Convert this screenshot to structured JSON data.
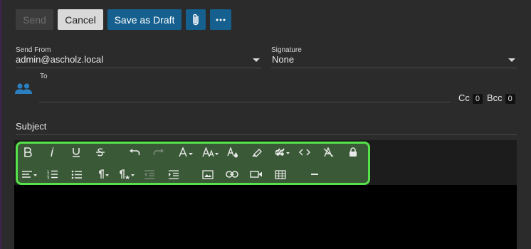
{
  "toolbar": {
    "send_label": "Send",
    "cancel_label": "Cancel",
    "draft_label": "Save as Draft",
    "attach_icon": "paperclip-icon",
    "more_icon": "more-horizontal-icon"
  },
  "send_from": {
    "label": "Send From",
    "value": "admin@ascholz.local"
  },
  "signature": {
    "label": "Signature",
    "value": "None"
  },
  "to": {
    "label": "To",
    "icon": "contacts-icon"
  },
  "cc": {
    "label": "Cc",
    "count": "0"
  },
  "bcc": {
    "label": "Bcc",
    "count": "0"
  },
  "subject": {
    "label": "Subject"
  },
  "editor": {
    "row1": [
      "bold-icon",
      "italic-icon",
      "underline-icon",
      "strikethrough-icon",
      "undo-icon",
      "redo-icon",
      "font-family-icon",
      "font-size-icon",
      "text-color-icon",
      "highlight-icon",
      "quote-icon",
      "code-icon",
      "clear-format-icon",
      "lock-icon"
    ],
    "row2": [
      "align-icon",
      "ordered-list-icon",
      "unordered-list-icon",
      "paragraph-icon",
      "paragraph-style-icon",
      "outdent-icon",
      "indent-icon",
      "image-icon",
      "link-icon",
      "video-icon",
      "table-icon",
      "horizontal-rule-icon"
    ]
  },
  "colors": {
    "accent": "#15608e",
    "highlight_outline": "#55e24a",
    "background": "#2b2b2b"
  }
}
